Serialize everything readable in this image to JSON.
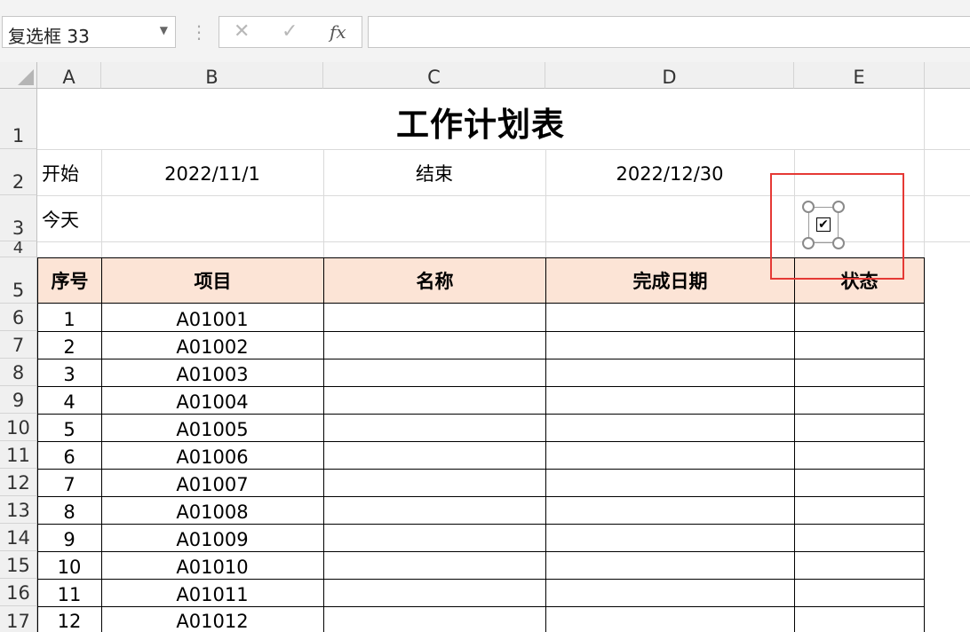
{
  "namebox": {
    "value": "复选框 33"
  },
  "formula_bar": {
    "fx": "fx",
    "cancel": "✕",
    "enter": "✓",
    "content": ""
  },
  "columns": [
    "A",
    "B",
    "C",
    "D",
    "E"
  ],
  "rows": [
    "1",
    "2",
    "3",
    "4",
    "5",
    "6",
    "7",
    "8",
    "9",
    "10",
    "11",
    "12",
    "13",
    "14",
    "15",
    "16",
    "17"
  ],
  "sheet": {
    "title": "工作计划表",
    "start_label": "开始",
    "start_value": "2022/11/1",
    "end_label": "结束",
    "end_value": "2022/12/30",
    "today_label": "今天"
  },
  "table": {
    "headers": [
      "序号",
      "项目",
      "名称",
      "完成日期",
      "状态"
    ],
    "rows": [
      {
        "no": "1",
        "item": "A01001"
      },
      {
        "no": "2",
        "item": "A01002"
      },
      {
        "no": "3",
        "item": "A01003"
      },
      {
        "no": "4",
        "item": "A01004"
      },
      {
        "no": "5",
        "item": "A01005"
      },
      {
        "no": "6",
        "item": "A01006"
      },
      {
        "no": "7",
        "item": "A01007"
      },
      {
        "no": "8",
        "item": "A01008"
      },
      {
        "no": "9",
        "item": "A01009"
      },
      {
        "no": "10",
        "item": "A01010"
      },
      {
        "no": "11",
        "item": "A01011"
      },
      {
        "no": "12",
        "item": "A01012"
      }
    ]
  },
  "checkbox": {
    "checked": true,
    "mark": "✔"
  },
  "colors": {
    "header_fill": "#fce4d6",
    "highlight": "#e53935"
  }
}
